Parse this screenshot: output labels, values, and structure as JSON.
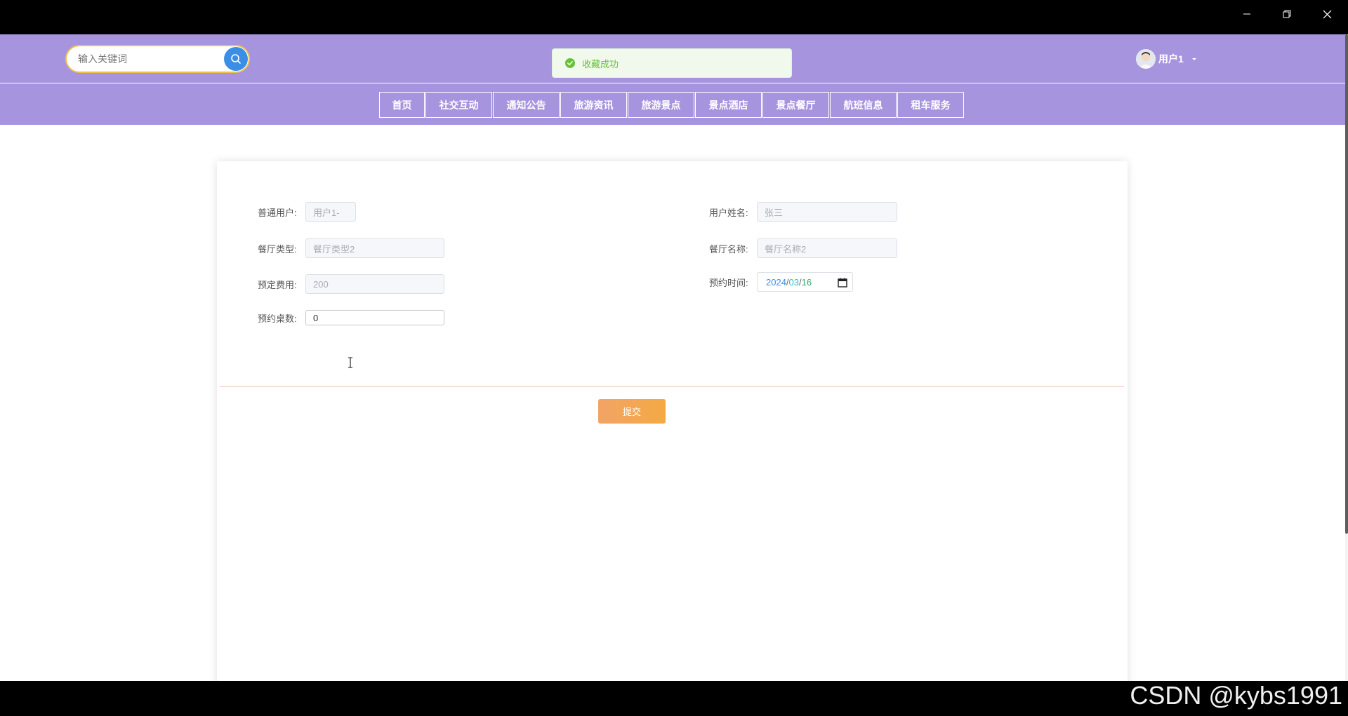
{
  "window": {
    "controls": [
      "minimize",
      "restore",
      "close"
    ]
  },
  "header": {
    "search": {
      "placeholder": "输入关键词",
      "button_icon": "search-icon"
    },
    "toast": {
      "text": "收藏成功",
      "icon": "check-circle-icon",
      "color": "#67c23a"
    },
    "user": {
      "name": "用户1",
      "avatar_icon": "avatar"
    },
    "bg_color": "#a794df"
  },
  "nav": {
    "items": [
      {
        "label": "首页"
      },
      {
        "label": "社交互动"
      },
      {
        "label": "通知公告"
      },
      {
        "label": "旅游资讯"
      },
      {
        "label": "旅游景点"
      },
      {
        "label": "景点酒店"
      },
      {
        "label": "景点餐厅"
      },
      {
        "label": "航班信息"
      },
      {
        "label": "租车服务"
      }
    ]
  },
  "form": {
    "fields": {
      "user": {
        "label": "普通用户:",
        "value": "用户1-"
      },
      "username": {
        "label": "用户姓名:",
        "value": "张三"
      },
      "restaurant_type": {
        "label": "餐厅类型:",
        "value": "餐厅类型2"
      },
      "restaurant_name": {
        "label": "餐厅名称:",
        "value": "餐厅名称2"
      },
      "fee": {
        "label": "预定费用:",
        "value": "200"
      },
      "time": {
        "label": "预约时间:",
        "year": "2024",
        "month": "03",
        "day": "16",
        "sep": "/"
      },
      "tables": {
        "label": "预约桌数:",
        "value": "0"
      }
    },
    "submit_label": "提交"
  },
  "footer": {
    "watermark": "CSDN @kybs1991"
  }
}
